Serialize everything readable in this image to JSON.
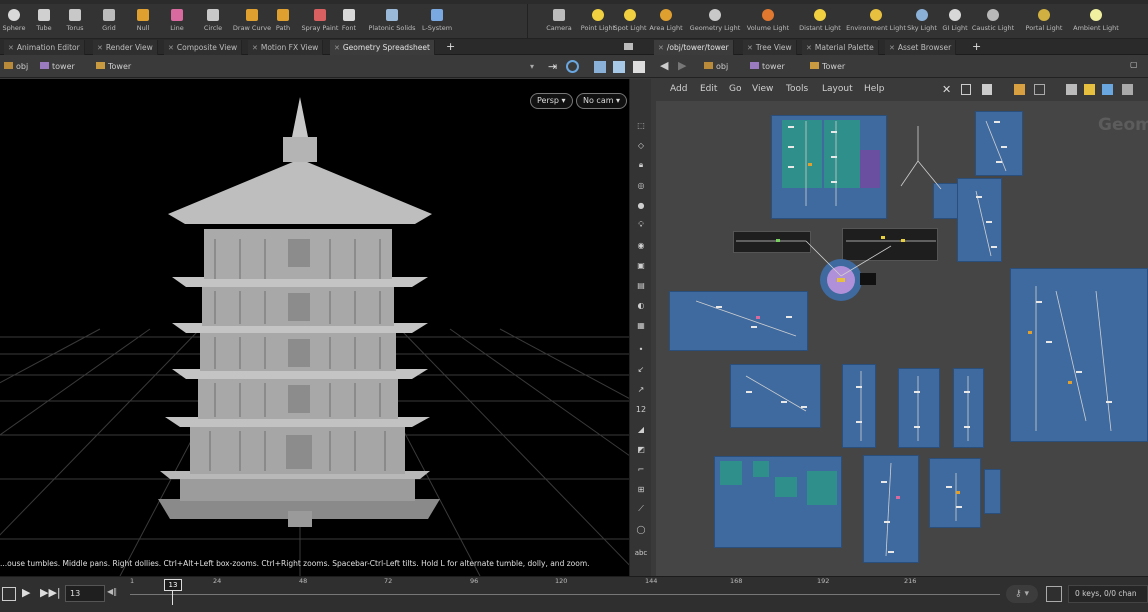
{
  "shelf": {
    "create_tools": [
      {
        "label": "Sphere",
        "icon": "sphere-icon"
      },
      {
        "label": "Tube",
        "icon": "tube-icon"
      },
      {
        "label": "Torus",
        "icon": "torus-icon"
      },
      {
        "label": "Grid",
        "icon": "grid-icon"
      },
      {
        "label": "Null",
        "icon": "null-icon"
      },
      {
        "label": "Line",
        "icon": "line-icon"
      },
      {
        "label": "Circle",
        "icon": "circle-icon"
      },
      {
        "label": "Draw Curve",
        "icon": "draw-curve-icon"
      },
      {
        "label": "Path",
        "icon": "path-icon"
      },
      {
        "label": "Spray Paint",
        "icon": "spray-paint-icon"
      },
      {
        "label": "Font",
        "icon": "font-icon"
      },
      {
        "label": "Platonic Solids",
        "icon": "platonic-solids-icon"
      },
      {
        "label": "L-System",
        "icon": "l-system-icon"
      }
    ],
    "light_tools": [
      {
        "label": "Camera",
        "icon": "camera-icon"
      },
      {
        "label": "Point Light",
        "icon": "point-light-icon"
      },
      {
        "label": "Spot Light",
        "icon": "spot-light-icon"
      },
      {
        "label": "Area Light",
        "icon": "area-light-icon"
      },
      {
        "label": "Geometry Light",
        "icon": "geometry-light-icon"
      },
      {
        "label": "Volume Light",
        "icon": "volume-light-icon"
      },
      {
        "label": "Distant Light",
        "icon": "distant-light-icon"
      },
      {
        "label": "Environment Light",
        "icon": "environment-light-icon"
      },
      {
        "label": "Sky Light",
        "icon": "sky-light-icon"
      },
      {
        "label": "GI Light",
        "icon": "gi-light-icon"
      },
      {
        "label": "Caustic Light",
        "icon": "caustic-light-icon"
      },
      {
        "label": "Portal Light",
        "icon": "portal-light-icon"
      },
      {
        "label": "Ambient Light",
        "icon": "ambient-light-icon"
      }
    ]
  },
  "left_tabs": [
    "Animation Editor",
    "Render View",
    "Composite View",
    "Motion FX View",
    "Geometry Spreadsheet"
  ],
  "right_tabs": [
    "/obj/tower/tower",
    "Tree View",
    "Material Palette",
    "Asset Browser"
  ],
  "left_path": {
    "root": "obj",
    "items": [
      "tower",
      "Tower"
    ]
  },
  "right_path": {
    "root": "obj",
    "items": [
      "tower",
      "Tower"
    ]
  },
  "viewport": {
    "camera_menu": "Persp",
    "cam_menu": "No cam",
    "status_text": "...ouse tumbles. Middle pans. Right dollies. Ctrl+Alt+Left box-zooms. Ctrl+Right zooms. Spacebar-Ctrl-Left tilts. Hold L for alternate tumble, dolly, and zoom."
  },
  "network_menu": [
    "Add",
    "Edit",
    "Go",
    "View",
    "Tools",
    "Layout",
    "Help"
  ],
  "network_watermark": "Geom",
  "timeline": {
    "current_frame": "13",
    "frame_marker": "13",
    "ticks": [
      "1",
      "24",
      "48",
      "72",
      "96",
      "120",
      "144",
      "168",
      "192",
      "216"
    ],
    "keys_status": "0 keys, 0/0 chan"
  },
  "colors": {
    "accent": "#e0a030",
    "network_box": "#3e6aa0",
    "node_teal": "#2f8f8a"
  }
}
